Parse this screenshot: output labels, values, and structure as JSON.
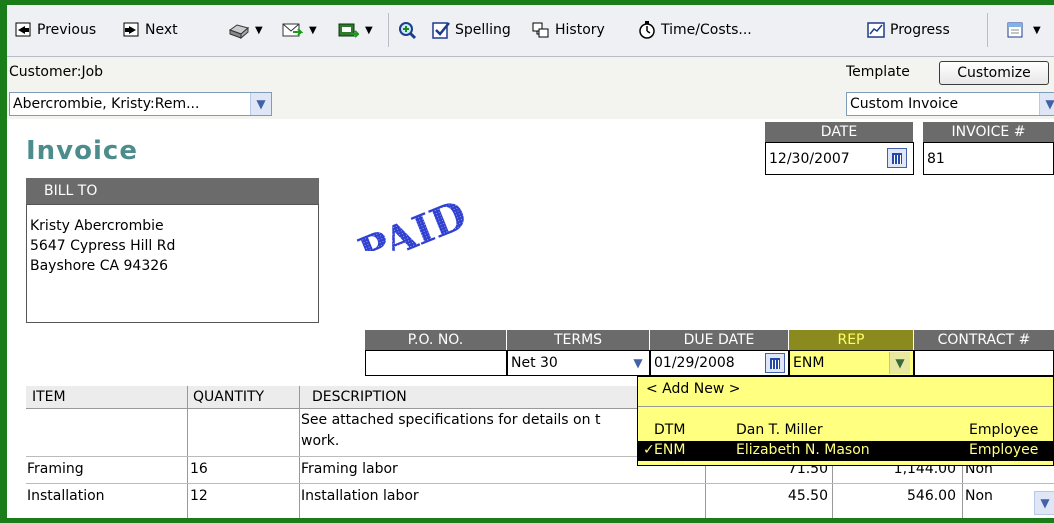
{
  "toolbar": {
    "previous": "Previous",
    "next": "Next",
    "spelling": "Spelling",
    "history": "History",
    "time_costs": "Time/Costs...",
    "progress": "Progress"
  },
  "header": {
    "customer_job_label": "Customer:Job",
    "customer_job_value": "Abercrombie, Kristy:Rem...",
    "template_label": "Template",
    "customize_button": "Customize",
    "template_value": "Custom Invoice"
  },
  "invoice": {
    "title": "Invoice",
    "stamp": "PAID",
    "date_label": "DATE",
    "date_value": "12/30/2007",
    "invoice_no_label": "INVOICE #",
    "invoice_no_value": "81",
    "bill_to_label": "BILL TO",
    "bill_to_lines": [
      "Kristy Abercrombie",
      "5647 Cypress Hill Rd",
      "Bayshore CA 94326"
    ],
    "po_label": "P.O. NO.",
    "po_value": "",
    "terms_label": "TERMS",
    "terms_value": "Net 30",
    "due_date_label": "DUE DATE",
    "due_date_value": "01/29/2008",
    "rep_label": "REP",
    "rep_value": "ENM",
    "contract_label": "CONTRACT #",
    "contract_value": ""
  },
  "table": {
    "columns": [
      "ITEM",
      "QUANTITY",
      "DESCRIPTION"
    ],
    "rows": [
      {
        "item": "",
        "quantity": "",
        "description_1": "See attached specifications for details on t",
        "description_2": "work.",
        "rate": "",
        "amount": "",
        "tax": ""
      },
      {
        "item": "Framing",
        "quantity": "16",
        "description_1": "Framing labor",
        "description_2": "",
        "rate": "71.50",
        "amount": "1,144.00",
        "tax": "Non"
      },
      {
        "item": "Installation",
        "quantity": "12",
        "description_1": "Installation labor",
        "description_2": "",
        "rate": "45.50",
        "amount": "546.00",
        "tax": "Non"
      }
    ]
  },
  "rep_dropdown": {
    "add_new": "< Add New >",
    "options": [
      {
        "code": "DTM",
        "name": "Dan T. Miller",
        "type": "Employee",
        "selected": false
      },
      {
        "code": "ENM",
        "name": "Elizabeth N. Mason",
        "type": "Employee",
        "selected": true
      }
    ],
    "check_mark": "✓"
  },
  "colors": {
    "window_border": "#1a7d1a",
    "title_teal": "#4c8c8c",
    "header_gray": "#6b6b6b",
    "rep_header": "#8a8a1f",
    "dropdown_bg": "#ffff80",
    "selected_bg": "#000000",
    "paid_stamp": "#2f3fd0"
  }
}
